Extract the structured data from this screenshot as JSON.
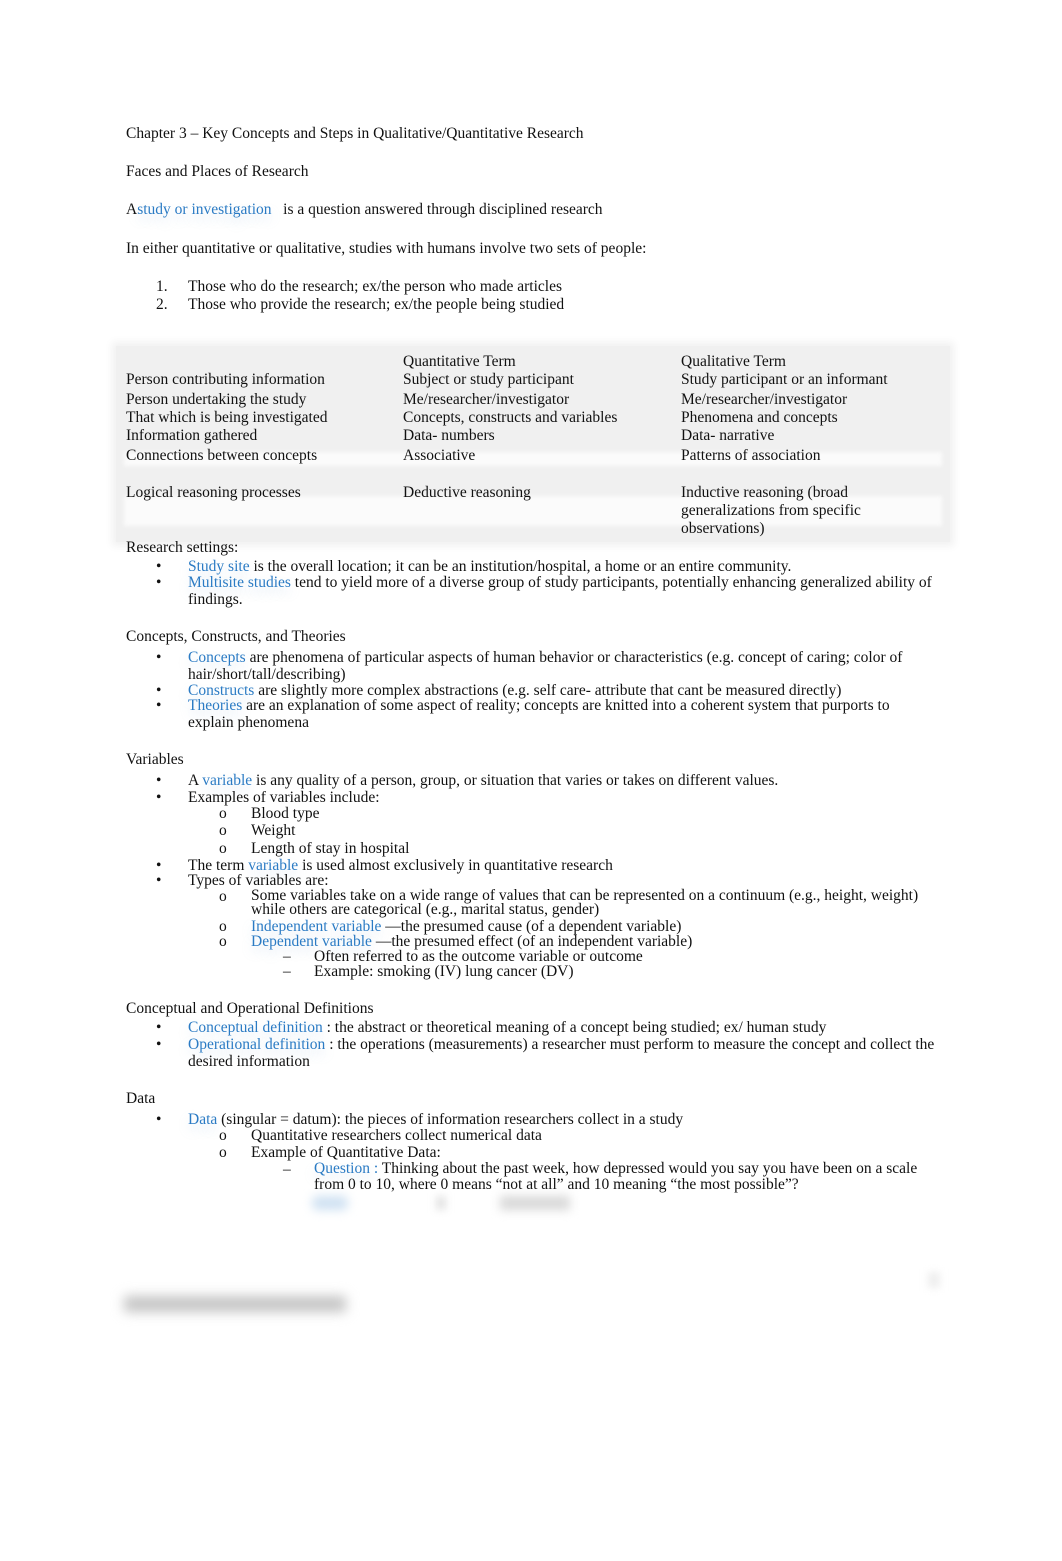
{
  "document": {
    "title": "Chapter 3 – Key Concepts and Steps in Qualitative/Quantitative Research",
    "section_faces": "Faces and Places of Research",
    "intro": {
      "prefix": "A",
      "term": "study or investigation",
      "rest": "is a question answered through disciplined research"
    },
    "people_intro": "In either quantitative or qualitative, studies with humans involve two sets of people:",
    "people_list": [
      {
        "num": "1.",
        "text": "Those who do the research; ex/the person who made articles"
      },
      {
        "num": "2.",
        "text": "Those who provide the research; ex/the people being studied"
      }
    ],
    "table": {
      "headers": [
        "",
        "Quantitative Term",
        "Qualitative Term"
      ],
      "rows": [
        [
          "Person contributing information",
          "Subject or study participant",
          "Study participant or an informant"
        ],
        [
          "Person undertaking the study",
          "Me/researcher/investigator",
          "Me/researcher/investigator"
        ],
        [
          "That which is being investigated",
          "Concepts, constructs and variables",
          "Phenomena and concepts"
        ],
        [
          "Information gathered",
          "Data- numbers",
          "Data- narrative"
        ],
        [
          "Connections between concepts",
          "Associative",
          "Patterns of association"
        ],
        [
          "Logical reasoning processes",
          "Deductive reasoning",
          "Inductive reasoning (broad generalizations from specific observations)"
        ]
      ],
      "last_row_qual_lines": [
        "Inductive reasoning (broad",
        "generalizations from specific",
        "observations)"
      ]
    },
    "research_settings": {
      "heading": "Research settings:",
      "items": [
        {
          "term": "Study  site",
          "text": " is the overall location; it can be an institution/hospital, a home or an entire community."
        },
        {
          "term": "Multisite  studies",
          "text": "  tend to yield more of a diverse group of study participants, potentially enhancing generalized ability of findings."
        }
      ]
    },
    "concepts": {
      "heading": "Concepts, Constructs, and Theories",
      "items": [
        {
          "term": "Concepts",
          "text": "  are phenomena of particular aspects of human behavior or characteristics (e.g. concept of caring; color of hair/short/tall/describing)"
        },
        {
          "term": "Constructs",
          "text": "   are slightly more complex abstractions (e.g. self care- attribute that cant be measured directly)"
        },
        {
          "term": "Theories",
          "text": "  are an explanation of some aspect of reality; concepts are knitted into a coherent system that purports to explain phenomena"
        }
      ]
    },
    "variables": {
      "heading": "Variables",
      "def_prefix": "A ",
      "def_term": "variable",
      "def_rest": "  is any quality of a person, group, or situation that varies or takes on different values.",
      "examples_label": "Examples of variables include:",
      "examples": [
        "Blood type",
        "Weight",
        "Length of stay in hospital"
      ],
      "term_usage_prefix": "The term ",
      "term_usage_term": "variable",
      "term_usage_rest": "  is used almost exclusively in quantitative research",
      "types_label": "Types of variables are:",
      "types": [
        {
          "term": "",
          "text": "Some variables take on a wide range of values that can be represented on a continuum (e.g., height, weight) while others are categorical (e.g., marital status, gender)"
        },
        {
          "term": "Independent variable",
          "text": "   —the presumed cause (of a dependent variable)"
        },
        {
          "term": "Dependent variable",
          "text": "   —the presumed effect (of an independent variable)"
        }
      ],
      "dependent_notes": [
        "Often referred to as the outcome variable or outcome",
        "Example: smoking (IV)   lung cancer (DV)"
      ],
      "sub_marker": "o",
      "dash_marker": "–",
      "bullet_marker": "•"
    },
    "definitions": {
      "heading": "Conceptual and Operational Definitions",
      "items": [
        {
          "term": "Conceptual definition",
          "text": "  : the abstract or theoretical meaning of a concept being studied; ex/ human study"
        },
        {
          "term": "Operational definition",
          "text": "   : the operations (measurements) a researcher must perform to measure the concept and collect the desired information"
        }
      ]
    },
    "data": {
      "heading": "Data",
      "def_term": "Data",
      "def_rest": "  (singular = datum): the pieces of information researchers collect in a study",
      "subs": [
        "Quantitative researchers collect numerical data",
        "Example of Quantitative Data:"
      ],
      "question_term": "Question :",
      "question_text": " Thinking about the past week, how depressed would you say you have been on a scale from 0 to 10, where 0 means “not at all” and 10 meaning “the most possible”?"
    }
  },
  "colors": {
    "term_blue": "#2b7bc4",
    "text": "#111111",
    "table_bg": "#f0f0f0"
  }
}
